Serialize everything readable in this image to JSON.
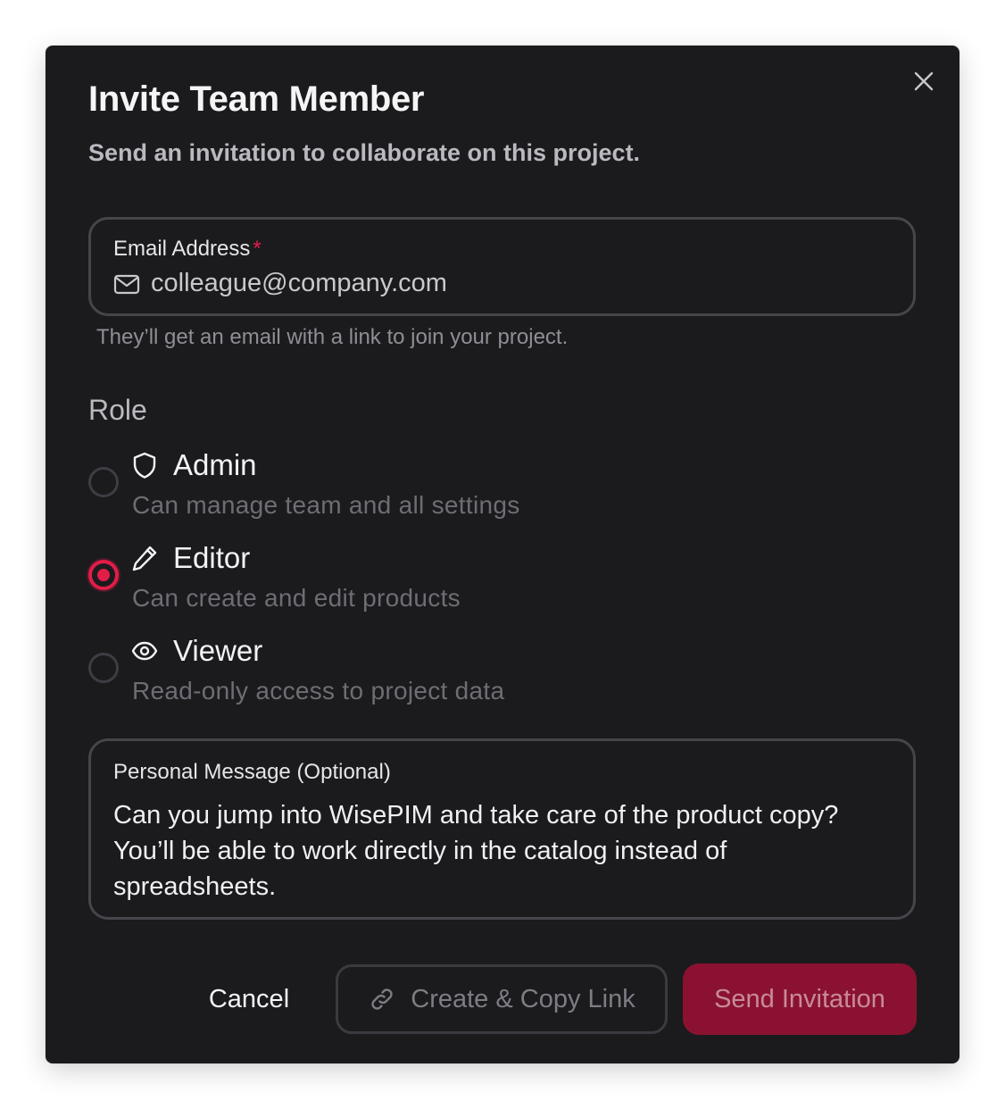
{
  "dialog": {
    "title": "Invite Team Member",
    "subtitle": "Send an invitation to collaborate on this project.",
    "close_icon": "close-icon"
  },
  "email": {
    "label": "Email Address",
    "required_mark": "*",
    "value": "colleague@company.com",
    "icon": "mail-icon",
    "helper": "They’ll get an email with a link to join your project."
  },
  "role": {
    "heading": "Role",
    "selected": "Editor",
    "options": [
      {
        "title": "Admin",
        "description": "Can manage team and all settings",
        "icon": "shield-icon",
        "checked": false
      },
      {
        "title": "Editor",
        "description": "Can create and edit products",
        "icon": "pencil-icon",
        "checked": true
      },
      {
        "title": "Viewer",
        "description": "Read-only access to project data",
        "icon": "eye-icon",
        "checked": false
      }
    ]
  },
  "message": {
    "label": "Personal Message (Optional)",
    "value": "Can you jump into WisePIM and take care of the product copy? You’ll be able to work directly in the catalog instead of spreadsheets."
  },
  "actions": {
    "cancel_label": "Cancel",
    "copy_link_label": "Create & Copy Link",
    "copy_link_icon": "link-icon",
    "send_label": "Send Invitation"
  },
  "colors": {
    "background": "#1b1b1e",
    "accent": "#e11d48",
    "send_button_bg": "#8a1230",
    "border": "#45454b"
  }
}
